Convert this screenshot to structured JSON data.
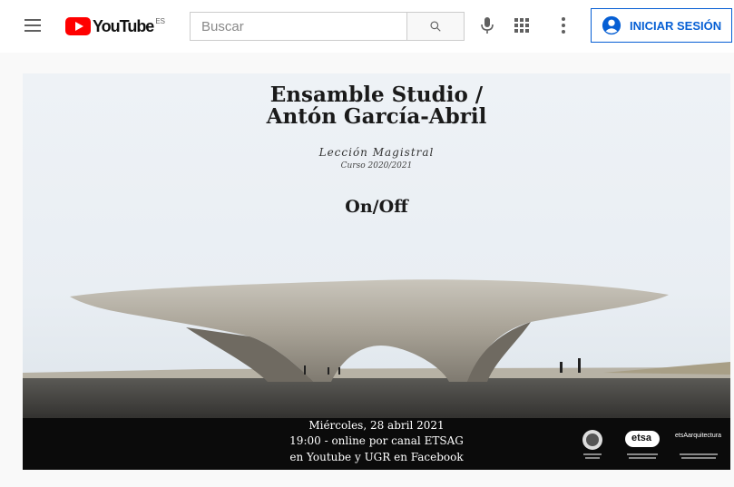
{
  "header": {
    "logo_text": "YouTube",
    "region": "ES",
    "search_placeholder": "Buscar",
    "signin_label": "INICIAR SESIÓN"
  },
  "icons": [
    "menu-icon",
    "search-icon",
    "microphone-icon",
    "apps-grid-icon",
    "more-vert-icon",
    "account-circle-icon"
  ],
  "video": {
    "title_line1": "Ensamble Studio /",
    "title_line2": "Antón García-Abril",
    "subtitle": "Lección Magistral",
    "course": "Curso 2020/2021",
    "theme": "On/Off",
    "info": [
      "Miércoles, 28 abril 2021",
      "19:00 - online por canal ETSAG",
      "en Youtube y UGR en Facebook"
    ],
    "logo_etsag": "etsa",
    "logo_etsa": "etsAarquitectura"
  },
  "colors": {
    "youtube_red": "#ff0000",
    "accent_blue": "#065fd4"
  }
}
